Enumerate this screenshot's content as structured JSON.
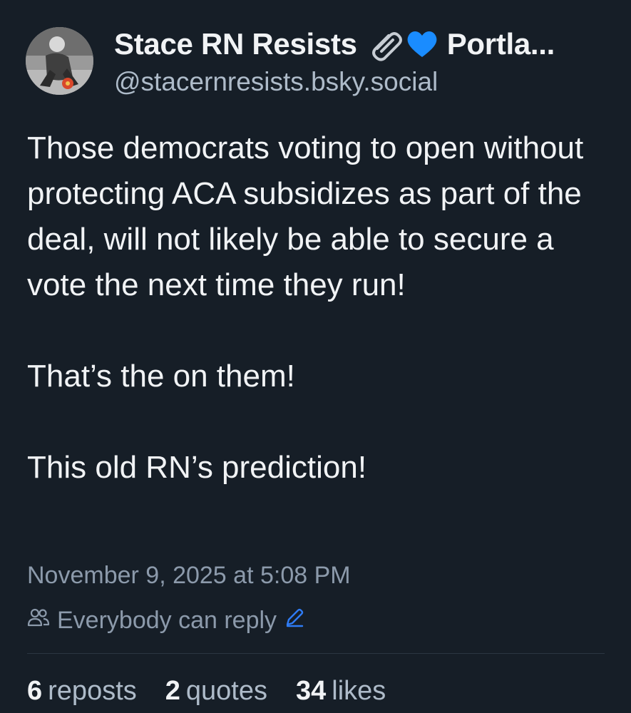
{
  "author": {
    "display_name": "Stace RN Resists",
    "emoji_icons": [
      "paperclip-icon",
      "blue-heart-icon"
    ],
    "name_tail": "Portla...",
    "handle": "@stacernresists.bsky.social"
  },
  "post": {
    "paragraphs": [
      "Those democrats voting to open without protecting ACA subsidizes as part of the deal, will not likely be able to secure a vote the next time they run!",
      "That’s the on them!",
      "This old RN’s prediction!"
    ],
    "timestamp": "November 9, 2025 at 5:08 PM",
    "reply_setting": "Everybody can reply"
  },
  "stats": {
    "reposts_count": "6",
    "reposts_label": "reposts",
    "quotes_count": "2",
    "quotes_label": "quotes",
    "likes_count": "34",
    "likes_label": "likes"
  },
  "colors": {
    "background": "#161e27",
    "text": "#f1f3f5",
    "muted": "#8c9aab",
    "accent": "#2f7cf6",
    "heart": "#1a8cff"
  }
}
